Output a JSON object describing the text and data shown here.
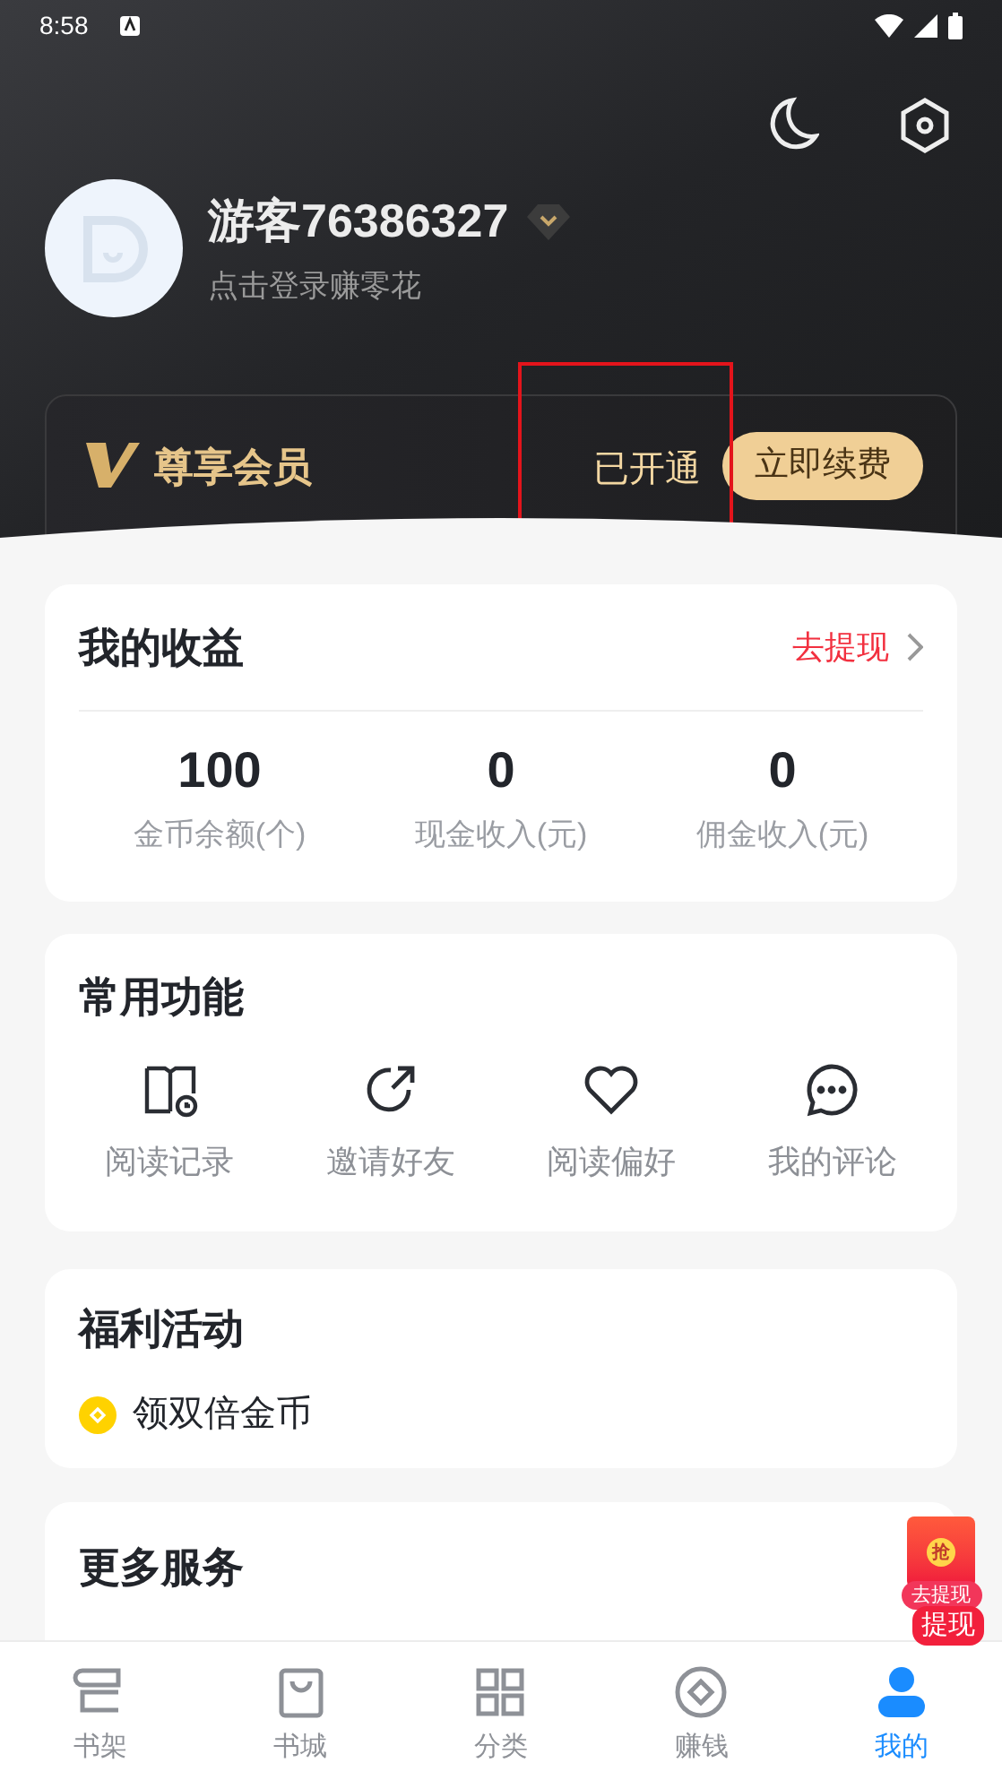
{
  "status_bar": {
    "time": "8:58"
  },
  "profile": {
    "name": "游客76386327",
    "subtitle": "点击登录赚零花"
  },
  "vip": {
    "title": "尊享会员",
    "status": "已开通",
    "button": "立即续费"
  },
  "earnings": {
    "title": "我的收益",
    "link": "去提现",
    "stats": [
      {
        "value": "100",
        "label": "金币余额(个)"
      },
      {
        "value": "0",
        "label": "现金收入(元)"
      },
      {
        "value": "0",
        "label": "佣金收入(元)"
      }
    ]
  },
  "functions": {
    "title": "常用功能",
    "items": [
      {
        "kind": "history",
        "label": "阅读记录"
      },
      {
        "kind": "share",
        "label": "邀请好友"
      },
      {
        "kind": "heart",
        "label": "阅读偏好"
      },
      {
        "kind": "comment",
        "label": "我的评论"
      }
    ]
  },
  "welfare": {
    "title": "福利活动",
    "items": [
      {
        "label": "领双倍金币"
      }
    ]
  },
  "more": {
    "title": "更多服务"
  },
  "floating_badge": {
    "icon_text": "抢",
    "tag": "去提现",
    "label": "提现"
  },
  "tabs": [
    {
      "kind": "shelf",
      "label": "书架",
      "selected": false
    },
    {
      "kind": "store",
      "label": "书城",
      "selected": false
    },
    {
      "kind": "grid",
      "label": "分类",
      "selected": false
    },
    {
      "kind": "coin",
      "label": "赚钱",
      "selected": false
    },
    {
      "kind": "me",
      "label": "我的",
      "selected": true
    }
  ]
}
